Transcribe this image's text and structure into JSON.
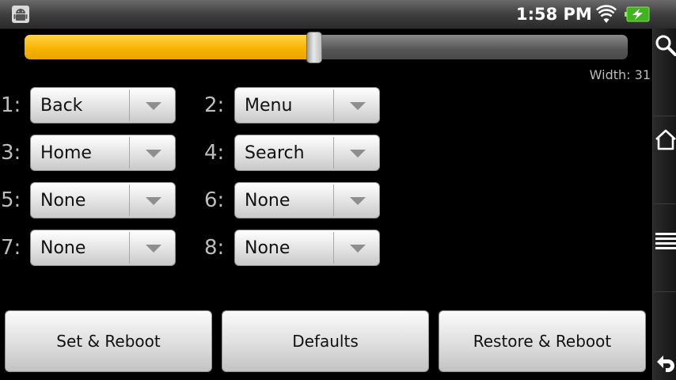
{
  "status_bar": {
    "time": "1:58 PM",
    "icons": [
      "android-icon",
      "wifi-icon",
      "battery-charging-icon"
    ]
  },
  "nav_bar": {
    "icons": [
      "search-icon",
      "home-icon",
      "menu-icon",
      "back-icon"
    ]
  },
  "slider": {
    "value_fraction": 0.48,
    "label": "Width: 31"
  },
  "slots": [
    {
      "num": "1:",
      "value": "Back"
    },
    {
      "num": "2:",
      "value": "Menu"
    },
    {
      "num": "3:",
      "value": "Home"
    },
    {
      "num": "4:",
      "value": "Search"
    },
    {
      "num": "5:",
      "value": "None"
    },
    {
      "num": "6:",
      "value": "None"
    },
    {
      "num": "7:",
      "value": "None"
    },
    {
      "num": "8:",
      "value": "None"
    }
  ],
  "buttons": {
    "set_reboot": "Set & Reboot",
    "defaults": "Defaults",
    "restore_reboot": "Restore & Reboot"
  },
  "colors": {
    "slider_fill": "#f7b500",
    "background": "#000000"
  }
}
